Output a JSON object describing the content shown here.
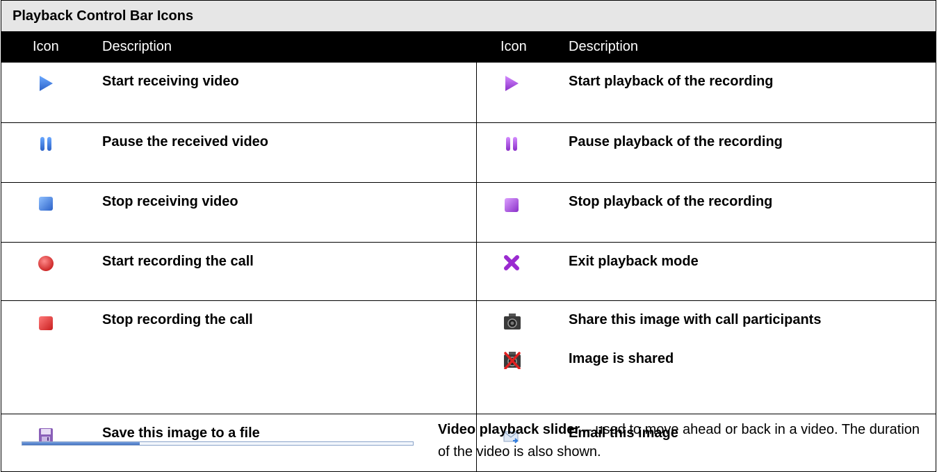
{
  "title": "Playback Control Bar Icons",
  "headers": {
    "icon_left": "Icon",
    "description_left": "Description",
    "icon_right": "Icon",
    "description_right": "Description"
  },
  "rows": [
    {
      "left": {
        "icon": "play-blue-icon",
        "text": "Start receiving video"
      },
      "right": {
        "icon": "play-purple-icon",
        "text": "Start playback of the recording"
      }
    },
    {
      "left": {
        "icon": "pause-blue-icon",
        "text": "Pause the received video"
      },
      "right": {
        "icon": "pause-purple-icon",
        "text": "Pause playback of the recording"
      }
    },
    {
      "left": {
        "icon": "stop-blue-icon",
        "text": "Stop receiving video"
      },
      "right": {
        "icon": "stop-purple-icon",
        "text": "Stop playback of the recording"
      }
    },
    {
      "left": {
        "icon": "record-icon",
        "text": "Start recording the call"
      },
      "right": {
        "icon": "exit-x-icon",
        "text": "Exit playback mode"
      }
    },
    {
      "left": {
        "icon": "stop-recording-icon",
        "text": "Stop recording the call"
      },
      "right": {
        "icon": "camera-share-icon",
        "text": "Share this image with call participants"
      },
      "right2": {
        "icon": "camera-shared-icon",
        "text": "Image is shared"
      }
    },
    {
      "left": {
        "icon": "save-disk-icon",
        "text": "Save this image to a file"
      },
      "right": {
        "icon": "email-icon",
        "text": "Email this image"
      }
    }
  ],
  "slider": {
    "label": "Video playback slider",
    "description": " – used to move ahead or back in a video. The duration of the video is also shown.",
    "progress": 0.3
  },
  "colors": {
    "blue": "#3f7fd8",
    "purple": "#a64ad8",
    "red": "#d83030",
    "header_bg": "#000000",
    "title_bg": "#e6e6e6"
  }
}
